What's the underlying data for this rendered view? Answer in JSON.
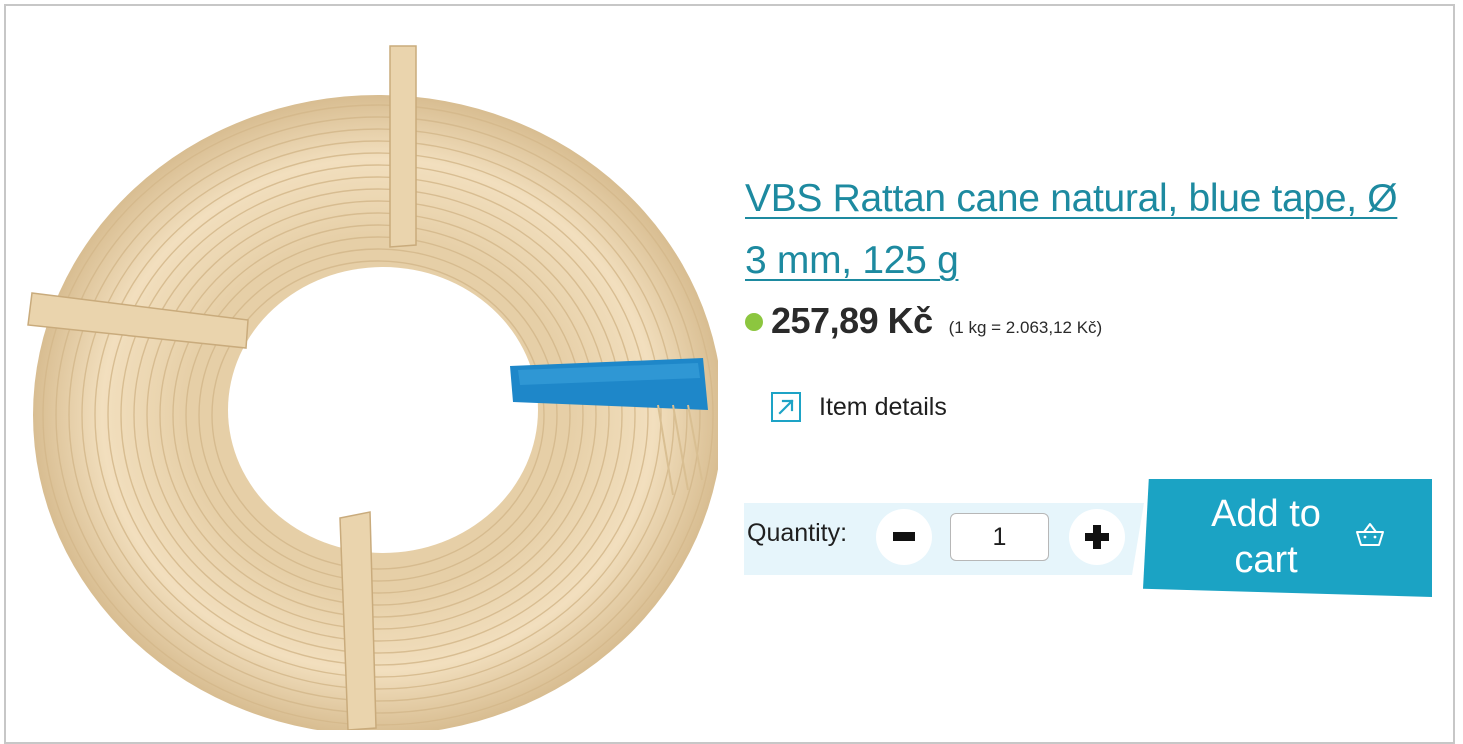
{
  "product": {
    "title": "VBS Rattan cane natural, blue tape, Ø 3 mm, 125 g",
    "price": "257,89 Kč",
    "unit_price": "(1 kg = 2.063,12 Kč)",
    "availability_color": "#8cc63f"
  },
  "details_link": {
    "label": "Item details",
    "icon": "arrow-up-right-icon"
  },
  "quantity": {
    "label": "Quantity:",
    "value": "1"
  },
  "cart": {
    "label": "Add to cart",
    "icon": "basket-icon"
  },
  "colors": {
    "accent": "#1ba3c4",
    "title_link": "#1d8aa0",
    "quantity_band": "#e6f5fb"
  }
}
